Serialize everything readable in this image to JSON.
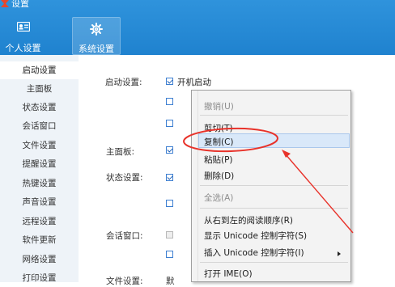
{
  "window": {
    "title": "设置"
  },
  "tabs": [
    {
      "label": "个人设置",
      "icon": "person-card-icon"
    },
    {
      "label": "系统设置",
      "icon": "gear-icon"
    }
  ],
  "sidebar": {
    "items": [
      {
        "label": "启动设置",
        "active": true
      },
      {
        "label": "主面板"
      },
      {
        "label": "状态设置"
      },
      {
        "label": "会话窗口"
      },
      {
        "label": "文件设置"
      },
      {
        "label": "提醒设置"
      },
      {
        "label": "热键设置"
      },
      {
        "label": "声音设置"
      },
      {
        "label": "远程设置"
      },
      {
        "label": "软件更新"
      },
      {
        "label": "网络设置"
      },
      {
        "label": "打印设置"
      }
    ]
  },
  "main": {
    "sections": {
      "startup": "启动设置:",
      "main_panel": "主面板:",
      "status": "状态设置:",
      "chat_window": "会话窗口:",
      "file": "文件设置:",
      "file_extra": "默"
    },
    "startup_autostart": {
      "label": "开机启动",
      "checked": true
    }
  },
  "context_menu": {
    "items": {
      "undo": "撤销(U)",
      "cut": "剪切(T)",
      "copy": "复制(C)",
      "paste": "粘贴(P)",
      "delete": "删除(D)",
      "select_all": "全选(A)",
      "rtl": "从右到左的阅读顺序(R)",
      "show_unicode": "显示 Unicode 控制字符(S)",
      "insert_unicode": "插入 Unicode 控制字符(I)",
      "open_ime": "打开 IME(O)"
    }
  },
  "annotation": {
    "color": "#e8322a"
  }
}
